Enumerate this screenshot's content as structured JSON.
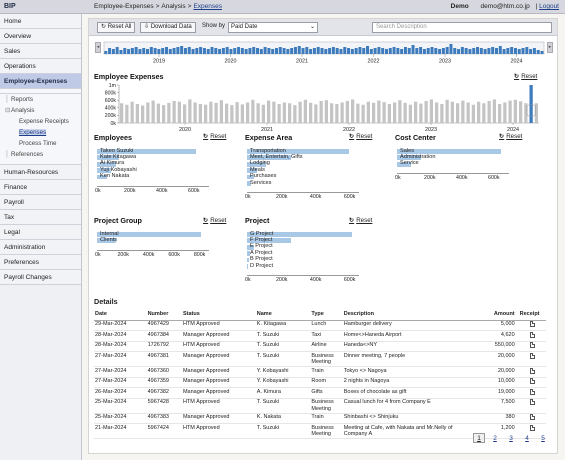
{
  "app": {
    "title": "BIP"
  },
  "breadcrumb": {
    "items": [
      "Employee-Expenses",
      "Analysis"
    ],
    "current": "Expenses"
  },
  "user": {
    "demo_label": "Demo",
    "email": "demo@htm.co.jp",
    "logout": "Logout"
  },
  "sidebar": {
    "items": [
      "Home",
      "Overview",
      "Sales",
      "Operations"
    ],
    "active": "Employee-Expenses",
    "sub": {
      "reports": "Reports",
      "analysis": "Analysis",
      "expense_receipts": "Expense Receipts",
      "expenses": "Expenses",
      "process_time": "Process Time",
      "references": "References"
    },
    "more": [
      "Human-Resources",
      "Finance",
      "Payroll",
      "Tax",
      "Legal",
      "Administration",
      "Preferences",
      "Payroll Changes"
    ]
  },
  "toolbar": {
    "reset_all": "Reset All",
    "download": "Download Data",
    "show_by_label": "Show by",
    "show_by_value": "Paid Date",
    "search_placeholder": "Search Description"
  },
  "timeline": {
    "years": [
      "2019",
      "2020",
      "2021",
      "2022",
      "2023",
      "2024"
    ],
    "values": [
      3,
      6,
      5,
      7,
      4,
      6,
      5,
      6,
      7,
      5,
      6,
      5,
      7,
      6,
      5,
      6,
      7,
      5,
      6,
      7,
      8,
      6,
      7,
      5,
      6,
      7,
      6,
      5,
      7,
      6,
      5,
      6,
      7,
      5,
      6,
      7,
      6,
      5,
      6,
      7,
      6,
      5,
      7,
      6,
      5,
      6,
      7,
      6,
      5,
      6,
      7,
      8,
      6,
      7,
      5,
      6,
      7,
      6,
      5,
      6,
      7,
      6,
      5,
      7,
      6,
      5,
      6,
      7,
      6,
      8,
      5,
      6,
      7,
      6,
      5,
      6,
      7,
      6,
      5,
      7,
      6,
      9,
      6,
      7,
      5,
      6,
      7,
      6,
      5,
      6,
      7,
      10,
      6,
      5,
      7,
      6,
      5,
      6,
      7,
      6,
      5,
      6,
      7,
      6,
      8,
      5,
      6,
      7,
      6,
      5,
      6,
      7,
      5,
      6,
      4,
      3
    ]
  },
  "expenses_chart": {
    "title": "Employee Expenses",
    "reset": "Reset",
    "y_ticks": [
      "1m",
      "800k",
      "600k",
      "400k",
      "200k",
      "0k"
    ],
    "x_ticks": [
      "2020",
      "2021",
      "2022",
      "2023",
      "2024"
    ],
    "values": [
      520,
      480,
      560,
      500,
      460,
      540,
      590,
      510,
      470,
      530,
      580,
      560,
      490,
      620,
      540,
      500,
      480,
      560,
      530,
      600,
      510,
      470,
      550,
      490,
      540,
      610,
      520,
      480,
      590,
      560,
      500,
      540,
      520,
      470,
      560,
      610,
      530,
      490,
      580,
      600,
      520,
      500,
      540,
      580,
      620,
      510,
      480,
      560,
      530,
      590,
      550,
      500,
      540,
      600,
      530,
      480,
      560,
      510,
      580,
      620,
      540,
      500,
      610,
      560,
      520,
      590,
      540,
      480,
      560,
      520,
      580,
      620,
      500,
      540,
      590,
      610,
      570,
      520,
      1000,
      520
    ]
  },
  "filters": {
    "employees": {
      "title": "Employees",
      "reset": "Reset",
      "items": [
        "Takeo Suzuki",
        "Kate Kitagawa",
        "Ai Kimura",
        "Yuji Kobayashi",
        "Ken Nakata"
      ],
      "values": [
        620,
        140,
        120,
        90,
        60
      ],
      "ticks": [
        "0k",
        "200k",
        "400k",
        "600k"
      ],
      "max": 700
    },
    "expense_area": {
      "title": "Expense Area",
      "reset": "Reset",
      "items": [
        "Transportation",
        "Meet, Entertain, Gifts",
        "Lodging",
        "Meals",
        "Purchases",
        "Services"
      ],
      "values": [
        600,
        260,
        110,
        60,
        40,
        25
      ],
      "ticks": [
        "0k",
        "200k",
        "400k",
        "600k"
      ],
      "max": 660
    },
    "cost_center": {
      "title": "Cost Center",
      "reset": "Reset",
      "items": [
        "Sales",
        "Administration",
        "Service"
      ],
      "values": [
        650,
        150,
        90
      ],
      "ticks": [
        "0k",
        "200k",
        "400k",
        "600k"
      ],
      "max": 700
    },
    "project_group": {
      "title": "Project Group",
      "reset": "Reset",
      "items": [
        "Internal",
        "Clients"
      ],
      "values": [
        820,
        150
      ],
      "ticks": [
        "0k",
        "200k",
        "400k",
        "600k",
        "800k"
      ],
      "max": 880
    },
    "project": {
      "title": "Project",
      "reset": "Reset",
      "items": [
        "G Project",
        "F Project",
        "E Project",
        "A Project",
        "B Project",
        "D Project"
      ],
      "values": [
        620,
        260,
        40,
        20,
        10,
        5
      ],
      "ticks": [
        "0k",
        "200k",
        "400k",
        "600k"
      ],
      "max": 660
    }
  },
  "details": {
    "title": "Details",
    "columns": [
      "Date",
      "Number",
      "Status",
      "Name",
      "Type",
      "Description",
      "Amount",
      "Receipt"
    ],
    "rows": [
      [
        "29-Mar-2024",
        "4967429",
        "HTM Approved",
        "K. Kitagawa",
        "Lunch",
        "Hamburger delivery",
        "5,000"
      ],
      [
        "28-Mar-2024",
        "4967384",
        "Manager Approved",
        "T. Suzuki",
        "Taxi",
        "Home<>Haneda Airport",
        "4,620"
      ],
      [
        "28-Mar-2024",
        "1726792",
        "HTM Approved",
        "T. Suzuki",
        "Airline",
        "Haneda<>NY",
        "550,000"
      ],
      [
        "27-Mar-2024",
        "4967381",
        "Manager Approved",
        "T. Suzuki",
        "Business Meeting",
        "Dinner meeting, 7 people",
        "20,000"
      ],
      [
        "27-Mar-2024",
        "4967360",
        "Manager Approved",
        "Y. Kobayashi",
        "Train",
        "Tokyo <> Nagoya",
        "20,000"
      ],
      [
        "27-Mar-2024",
        "4967359",
        "Manager Approved",
        "Y. Kobayashi",
        "Room",
        "2 nights in Nagoya",
        "10,000"
      ],
      [
        "26-Mar-2024",
        "4967382",
        "Manager Approved",
        "A. Kimura",
        "Gifts",
        "Boxes of chocolate as gift",
        "19,000"
      ],
      [
        "25-Mar-2024",
        "5967428",
        "HTM Approved",
        "T. Suzuki",
        "Business Meeting",
        "Casual lunch for 4 from Company E",
        "7,500"
      ],
      [
        "25-Mar-2024",
        "4967383",
        "Manager Approved",
        "K. Nakata",
        "Train",
        "Shinbashi <> Shinjuku",
        "380"
      ],
      [
        "21-Mar-2024",
        "5967424",
        "HTM Approved",
        "T. Suzuki",
        "Business Meeting",
        "Meeting at Cafe, with Nakata and Mr.Nelly of Company A",
        "1,200"
      ]
    ]
  },
  "pager": {
    "pages": [
      "1",
      "2",
      "3",
      "4",
      "5"
    ],
    "current": "1"
  },
  "colors": {
    "bar": "#a9c8e6",
    "timeline_bar": "#3d7bbd",
    "chart_bar": "#c4c4c4",
    "highlight": "#3d7bbd",
    "active_nav": "#bfcbe6"
  }
}
